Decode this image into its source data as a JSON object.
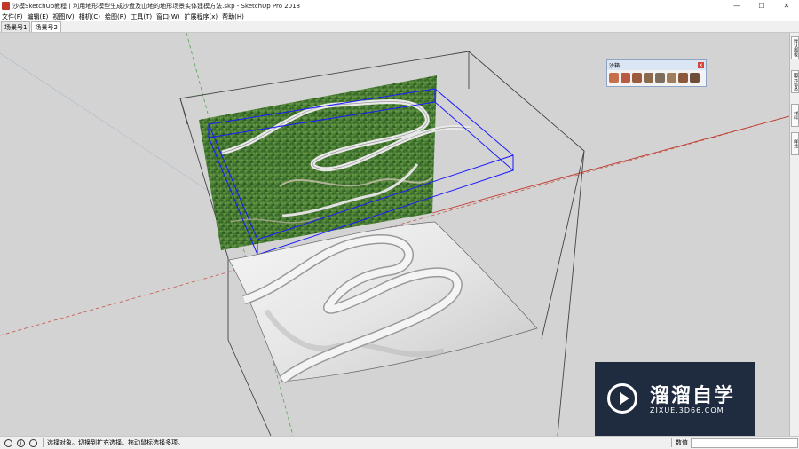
{
  "window": {
    "title": "沙模SketchUp教程丨利用地形模型生成沙盘及山地的地形场景实体建模方法.skp - SketchUp Pro 2018",
    "minimize": "—",
    "maximize": "☐",
    "close": "✕"
  },
  "menu": [
    "文件(F)",
    "编辑(E)",
    "视图(V)",
    "相机(C)",
    "绘图(R)",
    "工具(T)",
    "窗口(W)",
    "扩展程序(x)",
    "帮助(H)"
  ],
  "tabs": [
    {
      "label": "场景号1"
    },
    {
      "label": "场景号2"
    }
  ],
  "sandbox_toolbar": {
    "title": "沙箱",
    "close": "x",
    "tools": [
      {
        "icon": "sandbox-from-contours-icon",
        "color": "#c6704a"
      },
      {
        "icon": "sandbox-from-scratch-icon",
        "color": "#b85a44"
      },
      {
        "icon": "smoove-icon",
        "color": "#9c5b3c"
      },
      {
        "icon": "stamp-icon",
        "color": "#8a6a4a"
      },
      {
        "icon": "drape-icon",
        "color": "#7d6d5d"
      },
      {
        "icon": "add-detail-icon",
        "color": "#a07b5c"
      },
      {
        "icon": "flip-edge-icon",
        "color": "#8b5a3a"
      },
      {
        "icon": "sandbox-extra-icon",
        "color": "#6e4e3a"
      }
    ]
  },
  "right_tray": [
    "默认面板",
    "图元信息",
    "材料",
    "样式"
  ],
  "status": {
    "hint": "选择对象。切换到扩充选择。拖动鼠标选择多项。",
    "measurements_label": "数值",
    "measurements_value": ""
  },
  "watermark": {
    "title": "溜溜自学",
    "url": "ZIXUE.3D66.COM"
  },
  "colors": {
    "canvas": "#d3d3d3",
    "selection": "#1a1aff",
    "red_axis": "#c0392b",
    "green_axis": "#3a9a3a"
  }
}
